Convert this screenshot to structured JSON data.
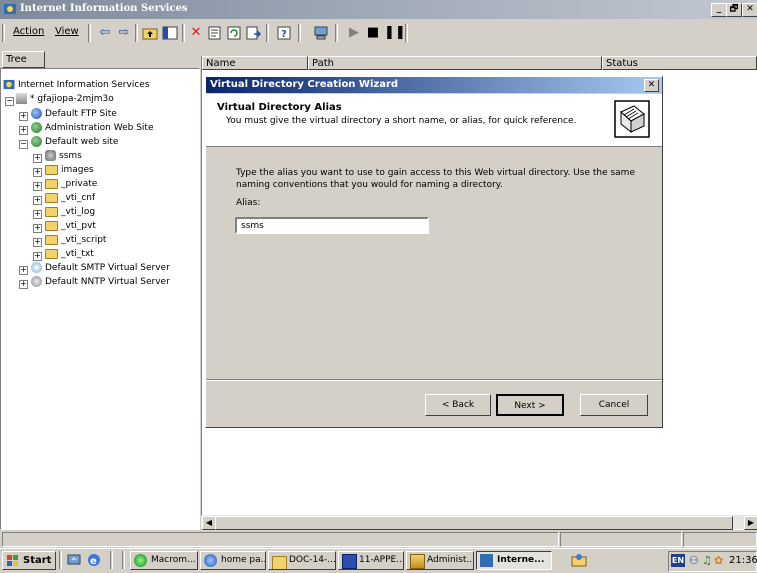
{
  "window": {
    "title": "Internet Information Services",
    "buttons": [
      "_",
      "🗗",
      "✕"
    ]
  },
  "menubar": {
    "items": [
      "Action",
      "View"
    ]
  },
  "tree": {
    "header": "Tree",
    "items": [
      {
        "label": "Internet Information Services",
        "icon": "iis-icon"
      },
      {
        "label": "* gfajiopa-2mjm3o",
        "icon": "server-icon"
      },
      {
        "label": "Default FTP Site",
        "icon": "ftp-site-icon"
      },
      {
        "label": "Administration Web Site",
        "icon": "web-site-icon"
      },
      {
        "label": "Default web site",
        "icon": "web-site-icon"
      },
      {
        "label": "ssms",
        "icon": "virtual-directory-icon"
      },
      {
        "label": "images",
        "icon": "folder-icon"
      },
      {
        "label": "_private",
        "icon": "folder-icon"
      },
      {
        "label": "_vti_cnf",
        "icon": "folder-icon"
      },
      {
        "label": "_vti_log",
        "icon": "folder-icon"
      },
      {
        "label": "_vti_pvt",
        "icon": "folder-icon"
      },
      {
        "label": "_vti_script",
        "icon": "folder-icon"
      },
      {
        "label": "_vti_txt",
        "icon": "folder-icon"
      },
      {
        "label": "Default SMTP Virtual Server",
        "icon": "smtp-icon"
      },
      {
        "label": "Default NNTP Virtual Server",
        "icon": "nntp-icon"
      }
    ]
  },
  "list": {
    "columns": [
      "Name",
      "Path",
      "Status"
    ]
  },
  "dialog": {
    "title": "Virtual Directory Creation Wizard",
    "heading": "Virtual Directory Alias",
    "subheading": "You must give the virtual directory a short name, or alias, for quick reference.",
    "instruction": "Type the alias you want to use to gain access to this Web virtual directory. Use the same naming conventions that you would for naming a directory.",
    "alias_label": "Alias:",
    "alias_value": "ssms",
    "back_label": "< Back",
    "next_label": "Next >",
    "cancel_label": "Cancel"
  },
  "taskbar": {
    "start_label": "Start",
    "buttons": [
      {
        "label": "Macrom...",
        "icon": "macromedia-icon",
        "active": false
      },
      {
        "label": "home pa...",
        "icon": "ie-icon",
        "active": false
      },
      {
        "label": "DOC-14-...",
        "icon": "folder-icon",
        "active": false
      },
      {
        "label": "11-APPE...",
        "icon": "word-icon",
        "active": false
      },
      {
        "label": "Administ...",
        "icon": "admin-tools-icon",
        "active": false
      },
      {
        "label": "Interne...",
        "icon": "iis-icon",
        "active": true
      }
    ],
    "tray": {
      "language": "EN",
      "clock": "21:36"
    }
  },
  "colors": {
    "dialog_title_start": "#0a246a",
    "dialog_title_end": "#a6caf0",
    "window_title_start": "#7e8a9c",
    "face": "#d4d0c8"
  }
}
